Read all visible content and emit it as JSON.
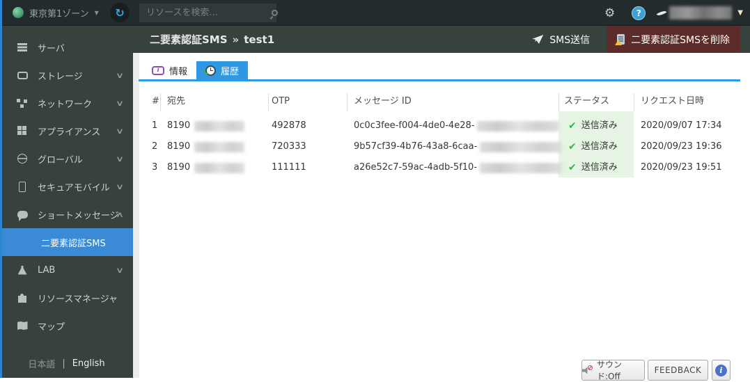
{
  "topbar": {
    "zone_label": "東京第1ゾーン",
    "search_placeholder": "リソースを検索..."
  },
  "sidebar": {
    "items": [
      {
        "label": "サーバ"
      },
      {
        "label": "ストレージ"
      },
      {
        "label": "ネットワーク"
      },
      {
        "label": "アプライアンス"
      },
      {
        "label": "グローバル"
      },
      {
        "label": "セキュアモバイル"
      },
      {
        "label": "ショートメッセージ"
      },
      {
        "label": "二要素認証SMS"
      },
      {
        "label": "LAB"
      },
      {
        "label": "リソースマネージャ"
      },
      {
        "label": "マップ"
      }
    ],
    "language_ja": "日本語",
    "language_divider": "|",
    "language_en": "English"
  },
  "page_header": {
    "title": "二要素認証SMS",
    "separator": "»",
    "resource_name": "test1",
    "send_button": "SMS送信",
    "delete_button": "二要素認証SMSを削除"
  },
  "tabs": {
    "info": "情報",
    "history": "履歴"
  },
  "table": {
    "columns": {
      "num": "#",
      "to": "宛先",
      "otp": "OTP",
      "message_id": "メッセージ ID",
      "status": "ステータス",
      "requested_at": "リクエスト日時"
    },
    "rows": [
      {
        "num": "1",
        "to_prefix": "8190",
        "otp": "492878",
        "message_id_prefix": "0c0c3fee-f004-4de0-4e28-",
        "status": "送信済み",
        "requested_at": "2020/09/07 17:34"
      },
      {
        "num": "2",
        "to_prefix": "8190",
        "otp": "720333",
        "message_id_prefix": "9b57cf39-4b76-43a8-6caa-",
        "status": "送信済み",
        "requested_at": "2020/09/23 19:36"
      },
      {
        "num": "3",
        "to_prefix": "8190",
        "otp": "111111",
        "message_id_prefix": "a26e52c7-59ac-4adb-5f10-",
        "status": "送信済み",
        "requested_at": "2020/09/23 19:51"
      }
    ]
  },
  "footer": {
    "sound_button": "サウンド:Off",
    "feedback_button": "FEEDBACK"
  },
  "icons": {
    "check": "✔",
    "chevron_down": "∨",
    "chevron_up": "∧",
    "dropdown": "▼",
    "gear": "⚙",
    "refresh": "↻",
    "question": "?",
    "info_letter": "i"
  },
  "colors": {
    "accent_blue": "#2e98e3",
    "selected_item_blue": "#3a8ad6",
    "delete_red": "#5e2c28",
    "status_green_bg": "#e6f5e3",
    "check_green": "#3bb24a",
    "topbar_bg": "#242b2d",
    "sidebar_bg": "#37423d"
  }
}
